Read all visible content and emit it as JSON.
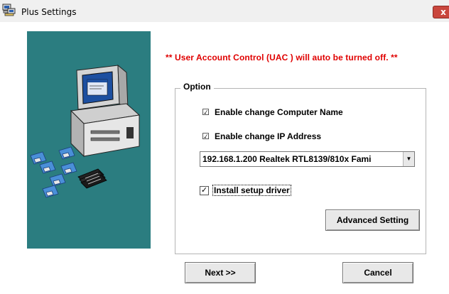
{
  "window": {
    "title": "Plus Settings",
    "close_label": "x"
  },
  "banner": {
    "warning": "** User Account Control (UAC ) will auto be turned off. **"
  },
  "option_group": {
    "legend": "Option",
    "enable_computer_name": {
      "label": "Enable change Computer Name",
      "checked": true,
      "mark": "☑"
    },
    "enable_ip_address": {
      "label": "Enable change IP Address",
      "checked": true,
      "mark": "☑"
    },
    "adapter_select": {
      "value": "192.168.1.200 Realtek RTL8139/810x Fami",
      "arrow": "▼"
    },
    "install_driver": {
      "label": "Install setup driver",
      "checked": true,
      "mark": "✓"
    },
    "advanced_button": "Advanced Setting"
  },
  "footer": {
    "next_button": "Next >>",
    "cancel_button": "Cancel"
  },
  "colors": {
    "side_panel": "#2b7d80",
    "warning_text": "#e00000",
    "close_button": "#c9463d"
  },
  "icons": {
    "title_icon": "computer-network-icon",
    "side_art": "computer-with-disks-illustration"
  }
}
